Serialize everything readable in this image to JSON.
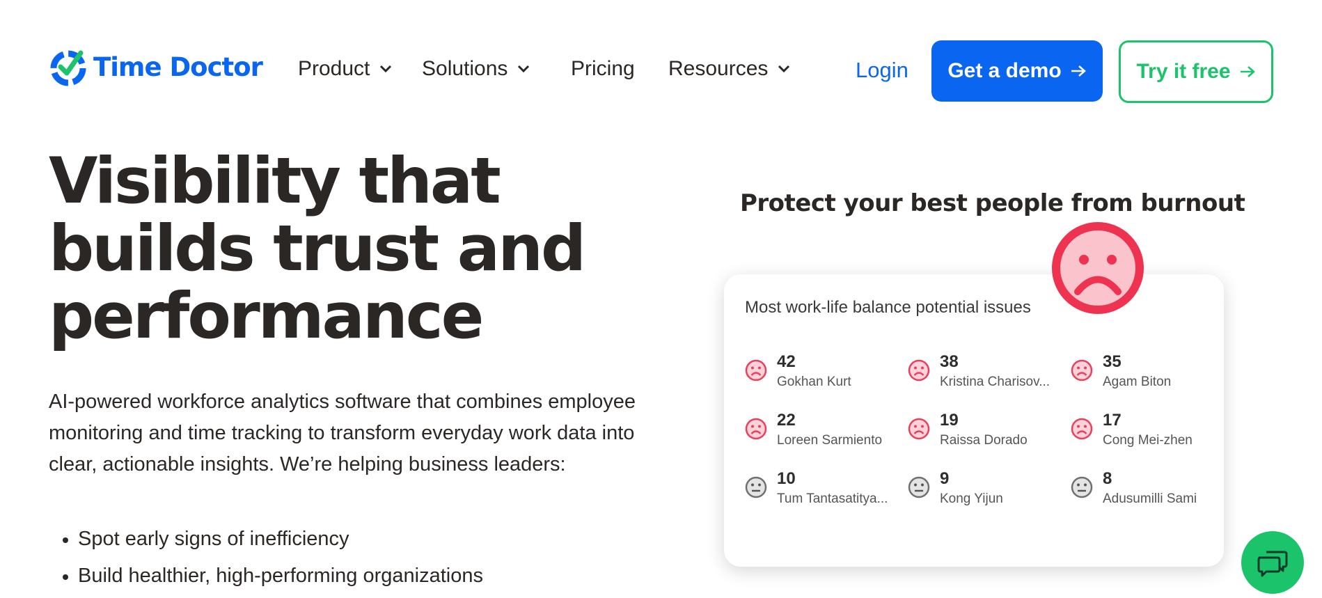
{
  "brand": {
    "name": "Time Doctor",
    "color": "#0a66f0",
    "accent": "#1bc36a"
  },
  "nav": {
    "items": [
      {
        "label": "Product",
        "has_dropdown": true
      },
      {
        "label": "Solutions",
        "has_dropdown": true
      },
      {
        "label": "Pricing",
        "has_dropdown": false
      },
      {
        "label": "Resources",
        "has_dropdown": true
      }
    ],
    "login": "Login",
    "demo_button": "Get a demo",
    "free_button": "Try it free"
  },
  "hero": {
    "title_lines": [
      "Visibility that",
      "builds trust and",
      "performance"
    ],
    "description": "AI-powered workforce analytics software that combines employee monitoring and time tracking to transform everyday work data into clear, actionable insights. We’re helping business leaders:",
    "bullets": [
      "Spot early signs of inefficiency",
      "Build healthier, high-performing organizations"
    ]
  },
  "illustration": {
    "title": "Protect your best people from burnout",
    "card_title": "Most work-life balance potential issues",
    "people": [
      {
        "value": "42",
        "name": "Gokhan Kurt",
        "status": "sad"
      },
      {
        "value": "38",
        "name": "Kristina Charisov...",
        "status": "sad"
      },
      {
        "value": "35",
        "name": "Agam Biton",
        "status": "sad"
      },
      {
        "value": "22",
        "name": "Loreen Sarmiento",
        "status": "sad"
      },
      {
        "value": "19",
        "name": "Raissa Dorado",
        "status": "sad"
      },
      {
        "value": "17",
        "name": "Cong Mei-zhen",
        "status": "sad"
      },
      {
        "value": "10",
        "name": "Tum Tantasatitya...",
        "status": "neutral"
      },
      {
        "value": "9",
        "name": "Kong Yijun",
        "status": "neutral"
      },
      {
        "value": "8",
        "name": "Adusumilli Sami",
        "status": "neutral"
      }
    ]
  },
  "chat_widget": {
    "icon": "chat-bubbles-icon"
  }
}
